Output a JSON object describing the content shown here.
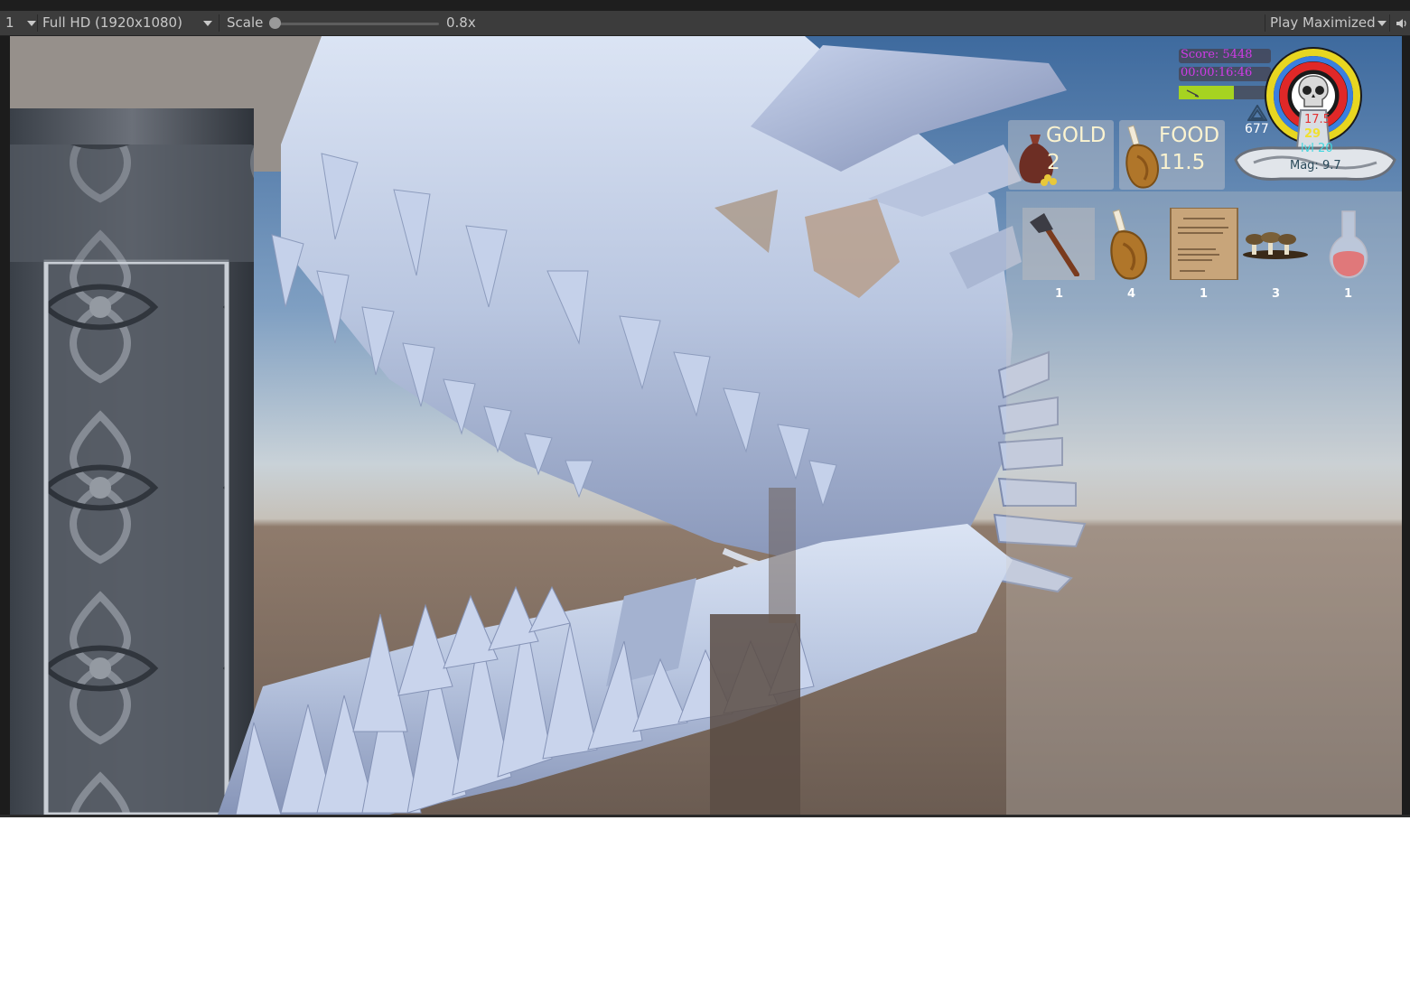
{
  "toolbar": {
    "display_index": "1",
    "resolution": "Full HD (1920x1080)",
    "scale_label": "Scale",
    "scale_value": "0.8x",
    "play_mode": "Play Maximized"
  },
  "hud": {
    "score": "Score: 5448",
    "timer": "00:00:16:46",
    "soul_count": "677",
    "stat_red": "17.5",
    "stat_yellow": "29",
    "level": "lvl 20",
    "magic": "Mag: 9.7",
    "gold_label": "GOLD",
    "gold_value": "2",
    "food_label": "FOOD",
    "food_value": "11.5",
    "experience_fraction": 0.6,
    "colors": {
      "score": "#d13be8",
      "timer": "#d13be8",
      "xp_bar": "#a6d321",
      "stat_red": "#e53232",
      "stat_yellow": "#f0e030",
      "level": "#40d8e0",
      "magic": "#2a4a5a"
    }
  },
  "inventory": {
    "items": [
      {
        "icon": "axe-icon",
        "count": "1"
      },
      {
        "icon": "meat-icon",
        "count": "4"
      },
      {
        "icon": "scroll-icon",
        "count": "1"
      },
      {
        "icon": "mushroom-icon",
        "count": "3"
      },
      {
        "icon": "potion-icon",
        "count": "1"
      }
    ]
  }
}
